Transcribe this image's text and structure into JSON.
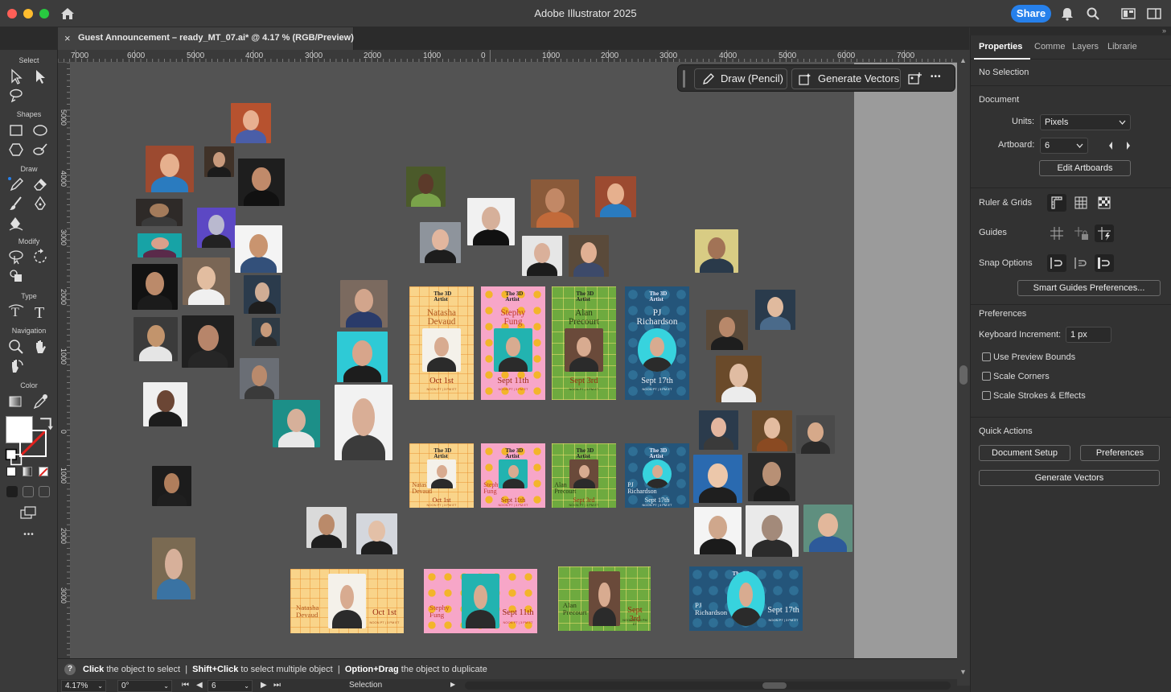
{
  "window": {
    "app_title": "Adobe Illustrator 2025",
    "share_label": "Share"
  },
  "tab": {
    "title": "Guest Announcement – ready_MT_07.ai* @ 4.17 % (RGB/Preview)",
    "close_glyph": "×"
  },
  "toolbar": {
    "categories": [
      "Select",
      "Shapes",
      "Draw",
      "Modify",
      "Type",
      "Navigation",
      "Color"
    ],
    "more_glyph": "•••"
  },
  "ruler": {
    "top_labels": [
      "7000",
      "6000",
      "5000",
      "4000",
      "3000",
      "2000",
      "1000",
      "0",
      "1000",
      "2000",
      "3000",
      "4000",
      "5000",
      "6000",
      "7000"
    ],
    "left_labels": [
      "5000",
      "4000",
      "3000",
      "2000",
      "1000",
      "0",
      "1000",
      "2000",
      "3000"
    ]
  },
  "context_bar": {
    "draw_label": "Draw (Pencil)",
    "generate_label": "Generate Vectors",
    "more_glyph": "•••"
  },
  "posters": [
    {
      "first": "Natasha",
      "last": "Devaud",
      "date": "Oct 1st",
      "color": "#f9d48a"
    },
    {
      "first": "Stephy",
      "last": "Fung",
      "date": "Sept 11th",
      "color": "#f7a6c8"
    },
    {
      "first": "Alan",
      "last": "Precourt",
      "date": "Sept 3rd",
      "color": "#6eaa3f"
    },
    {
      "first": "PJ",
      "last": "Richardson",
      "date": "Sept 17th",
      "color": "#24557a"
    }
  ],
  "poster_common": {
    "logo_line1": "The 3D",
    "logo_line2": "Artist",
    "time": "NOON PT | 3 PM ET",
    "presents": "PRESENTS",
    "a_talk_with": "A talk with"
  },
  "panel": {
    "tabs": [
      "Properties",
      "Comme",
      "Layers",
      "Librarie"
    ],
    "no_selection": "No Selection",
    "document_heading": "Document",
    "units_label": "Units:",
    "units_value": "Pixels",
    "artboard_label": "Artboard:",
    "artboard_value": "6",
    "edit_artboards": "Edit Artboards",
    "ruler_grids": "Ruler & Grids",
    "guides": "Guides",
    "snap_options": "Snap Options",
    "smart_guides": "Smart Guides Preferences...",
    "preferences_heading": "Preferences",
    "keyboard_increment_label": "Keyboard Increment:",
    "keyboard_increment_value": "1 px",
    "checkboxes": [
      "Use Preview Bounds",
      "Scale Corners",
      "Scale Strokes & Effects"
    ],
    "quick_actions_heading": "Quick Actions",
    "document_setup": "Document Setup",
    "preferences_button": "Preferences",
    "generate_vectors": "Generate Vectors"
  },
  "hint": {
    "q": "?",
    "p1_b": "Click",
    "p1": " the object to select  |  ",
    "p2_b": "Shift+Click",
    "p2": " to select multiple object  |  ",
    "p3_b": "Option+Drag",
    "p3": " the object to duplicate"
  },
  "status": {
    "zoom": "4.17%",
    "rotation": "0°",
    "artboard": "6",
    "tool": "Selection"
  }
}
